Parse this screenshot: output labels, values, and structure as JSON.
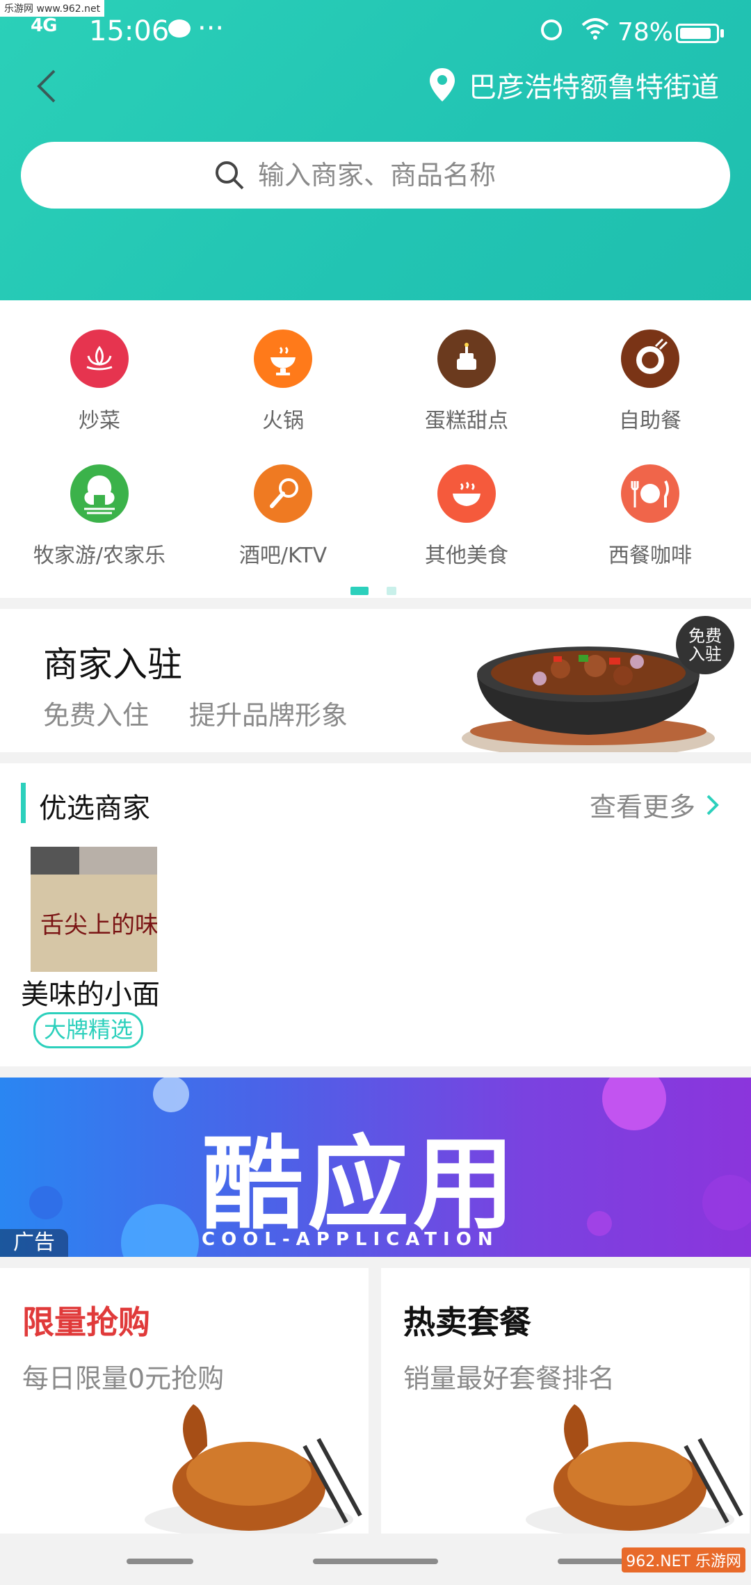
{
  "watermark_tl": "乐游网 www.962.net",
  "watermark_br": "962.NET 乐游网",
  "status": {
    "network": "4G",
    "time": "15:06",
    "battery": "78%"
  },
  "location": "巴彦浩特额鲁特街道",
  "search": {
    "placeholder": "输入商家、商品名称"
  },
  "categories": [
    {
      "label": "炒菜",
      "color": "#e6344f",
      "icon": "lotus-icon"
    },
    {
      "label": "火锅",
      "color": "#ff7a1a",
      "icon": "hotpot-icon"
    },
    {
      "label": "蛋糕甜点",
      "color": "#6b3a1e",
      "icon": "cake-icon"
    },
    {
      "label": "自助餐",
      "color": "#7a3416",
      "icon": "plate-icon"
    },
    {
      "label": "牧家游/农家乐",
      "color": "#3bb24a",
      "icon": "farmhouse-icon"
    },
    {
      "label": "酒吧/KTV",
      "color": "#ef7a22",
      "icon": "microphone-icon"
    },
    {
      "label": "其他美食",
      "color": "#f55a3c",
      "icon": "bowl-icon"
    },
    {
      "label": "西餐咖啡",
      "color": "#f0654a",
      "icon": "fork-knife-icon"
    }
  ],
  "join": {
    "title": "商家入驻",
    "sub1": "免费入住",
    "sub2": "提升品牌形象",
    "badge_l1": "免费",
    "badge_l2": "入驻"
  },
  "featured": {
    "title": "优选商家",
    "more": "查看更多",
    "shop_name": "美味的小面",
    "shop_tag": "大牌精选",
    "thumb_text": "舌尖上的味道"
  },
  "ad": {
    "title": "酷应用",
    "subtitle": "COOL-APPLICATION",
    "tag": "广告"
  },
  "promos": [
    {
      "title": "限量抢购",
      "sub": "每日限量0元抢购",
      "color": "#e03a3a"
    },
    {
      "title": "热卖套餐",
      "sub": "销量最好套餐排名",
      "color": "#111111"
    }
  ]
}
